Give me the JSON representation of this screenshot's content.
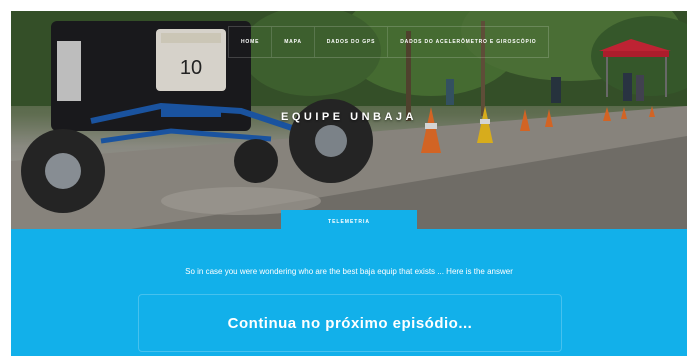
{
  "nav": {
    "items": [
      {
        "label": "Home"
      },
      {
        "label": "Mapa"
      },
      {
        "label": "Dados do GPS"
      },
      {
        "label": "Dados do Acelerômetro e Giroscópio"
      }
    ]
  },
  "hero": {
    "title": "EQUIPE UNBAJA",
    "car_number": "10"
  },
  "section_tab": {
    "label": "Telemetria"
  },
  "content": {
    "tagline": "So in case you were wondering who are the best baja equip that exists ... Here is the answer",
    "headline": "Continua no próximo episódio..."
  },
  "colors": {
    "accent": "#12b0ea"
  }
}
